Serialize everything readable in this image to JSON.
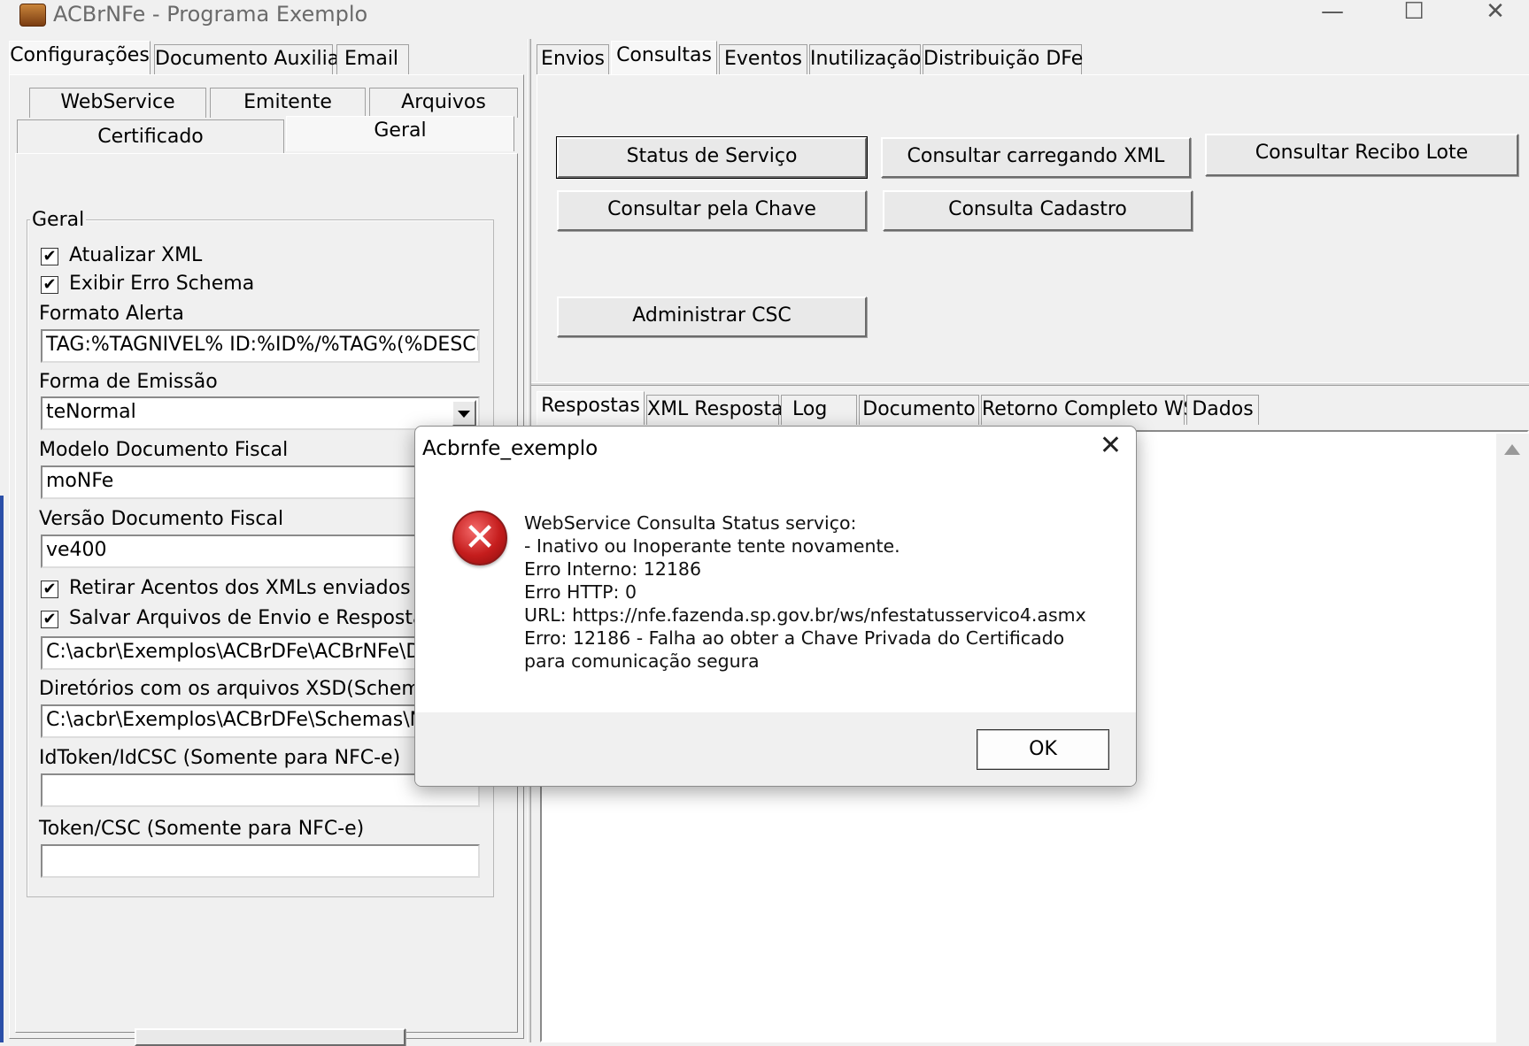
{
  "window": {
    "title": "ACBrNFe - Programa Exemplo",
    "minimize": "—",
    "maximize": "☐",
    "close": "✕"
  },
  "left_tabs": {
    "row1": [
      "Configurações",
      "Documento Auxiliar",
      "Email"
    ],
    "row2": [
      "WebService",
      "Emitente",
      "Arquivos"
    ],
    "row3": [
      "Certificado",
      "Geral"
    ]
  },
  "geral": {
    "group_title": "Geral",
    "atualizar_xml": "Atualizar XML",
    "exibir_erro_schema": "Exibir Erro Schema",
    "formato_alerta_label": "Formato Alerta",
    "formato_alerta_value": "TAG:%TAGNIVEL% ID:%ID%/%TAG%(%DESCRI",
    "forma_emissao_label": "Forma de Emissão",
    "forma_emissao_value": "teNormal",
    "modelo_label": "Modelo Documento Fiscal",
    "modelo_value": "moNFe",
    "versao_label": "Versão Documento Fiscal",
    "versao_value": "ve400",
    "retirar_acentos": "Retirar Acentos dos XMLs enviados",
    "salvar_arquivos": "Salvar Arquivos de Envio e Resposta",
    "path_value": "C:\\acbr\\Exemplos\\ACBrDFe\\ACBrNFe\\Delph",
    "xsd_label": "Diretórios com os arquivos XSD(Schemas)",
    "xsd_value": "C:\\acbr\\Exemplos\\ACBrDFe\\Schemas\\NFe",
    "idtoken_label": "IdToken/IdCSC (Somente para NFC-e)",
    "idtoken_value": "",
    "token_label": "Token/CSC (Somente para NFC-e)",
    "token_value": ""
  },
  "right_tabs": [
    "Envios",
    "Consultas",
    "Eventos",
    "Inutilização",
    "Distribuição DFe"
  ],
  "consultas_buttons": {
    "status_servico": "Status de Serviço",
    "consultar_xml": "Consultar carregando XML",
    "consultar_recibo": "Consultar Recibo Lote",
    "consultar_chave": "Consultar pela Chave",
    "consulta_cadastro": "Consulta Cadastro",
    "administrar_csc": "Administrar CSC"
  },
  "bottom_tabs": [
    "Respostas",
    "XML Resposta",
    "Log",
    "Documento",
    "Retorno Completo WS",
    "Dados"
  ],
  "dialog": {
    "title": "Acbrnfe_exemplo",
    "close": "✕",
    "icon": "error-icon",
    "lines": [
      "WebService Consulta Status serviço:",
      "- Inativo ou Inoperante tente novamente.",
      "Erro Interno: 12186",
      "Erro HTTP: 0",
      "URL: https://nfe.fazenda.sp.gov.br/ws/nfestatusservico4.asmx",
      "Erro: 12186 - Falha ao obter a Chave Privada do Certificado",
      "para comunicação segura"
    ],
    "ok": "OK"
  },
  "colors": {
    "error_red": "#c51d1d",
    "window_bg": "#f0f0f0"
  }
}
